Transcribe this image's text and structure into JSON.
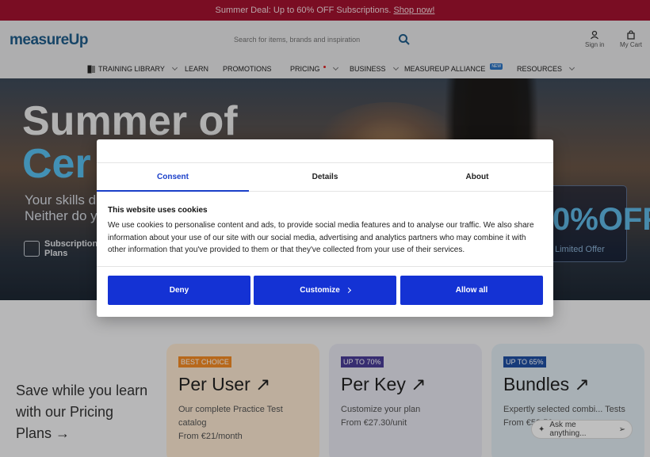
{
  "promo": {
    "text": "Summer Deal: Up to 60% OFF Subscriptions.",
    "link": "Shop now!"
  },
  "header": {
    "logo": "measureUp",
    "search_placeholder": "Search for items, brands and inspiration",
    "sign_in": "Sign in",
    "cart": "My Cart"
  },
  "nav": {
    "items": [
      {
        "label": "TRAINING LIBRARY"
      },
      {
        "label": "LEARN"
      },
      {
        "label": "PROMOTIONS"
      },
      {
        "label": "PRICING"
      },
      {
        "label": "BUSINESS"
      },
      {
        "label": "MEASUREUP ALLIANCE",
        "badge": "NEW"
      },
      {
        "label": "RESOURCES"
      }
    ]
  },
  "hero": {
    "title_line1": "Summer of",
    "title_line2": "Cer",
    "sub_line1": "Your skills d",
    "sub_line2": "Neither do y",
    "plans_line1": "Subscription",
    "plans_line2": "Plans",
    "offer_big": "0%OFF",
    "offer_limited": "Limited Offer"
  },
  "pricing": {
    "intro": "Save while you learn with our Pricing Plans",
    "cards": [
      {
        "badge": "BEST CHOICE",
        "title": "Per User",
        "desc": "Our complete Practice Test catalog",
        "price": "From €21/month"
      },
      {
        "badge": "UP TO 70%",
        "title": "Per Key",
        "desc": "Customize your plan",
        "price": "From €27.30/unit"
      },
      {
        "badge": "UP TO 65%",
        "title": "Bundles",
        "desc": "Expertly selected combi... Tests",
        "price": "From €52.50"
      }
    ]
  },
  "chat": {
    "placeholder": "Ask me anything..."
  },
  "cookie": {
    "tabs": [
      "Consent",
      "Details",
      "About"
    ],
    "heading": "This website uses cookies",
    "body": "We use cookies to personalise content and ads, to provide social media features and to analyse our traffic. We also share information about your use of our site with our social media, advertising and analytics partners who may combine it with other information that you've provided to them or that they've collected from your use of their services.",
    "deny": "Deny",
    "customize": "Customize",
    "allow": "Allow all"
  },
  "colors": {
    "promo_bg": "#a3122f",
    "accent_blue": "#1432d4",
    "logo_blue": "#1f5c8a",
    "hero_cyan": "#59c0f0"
  }
}
